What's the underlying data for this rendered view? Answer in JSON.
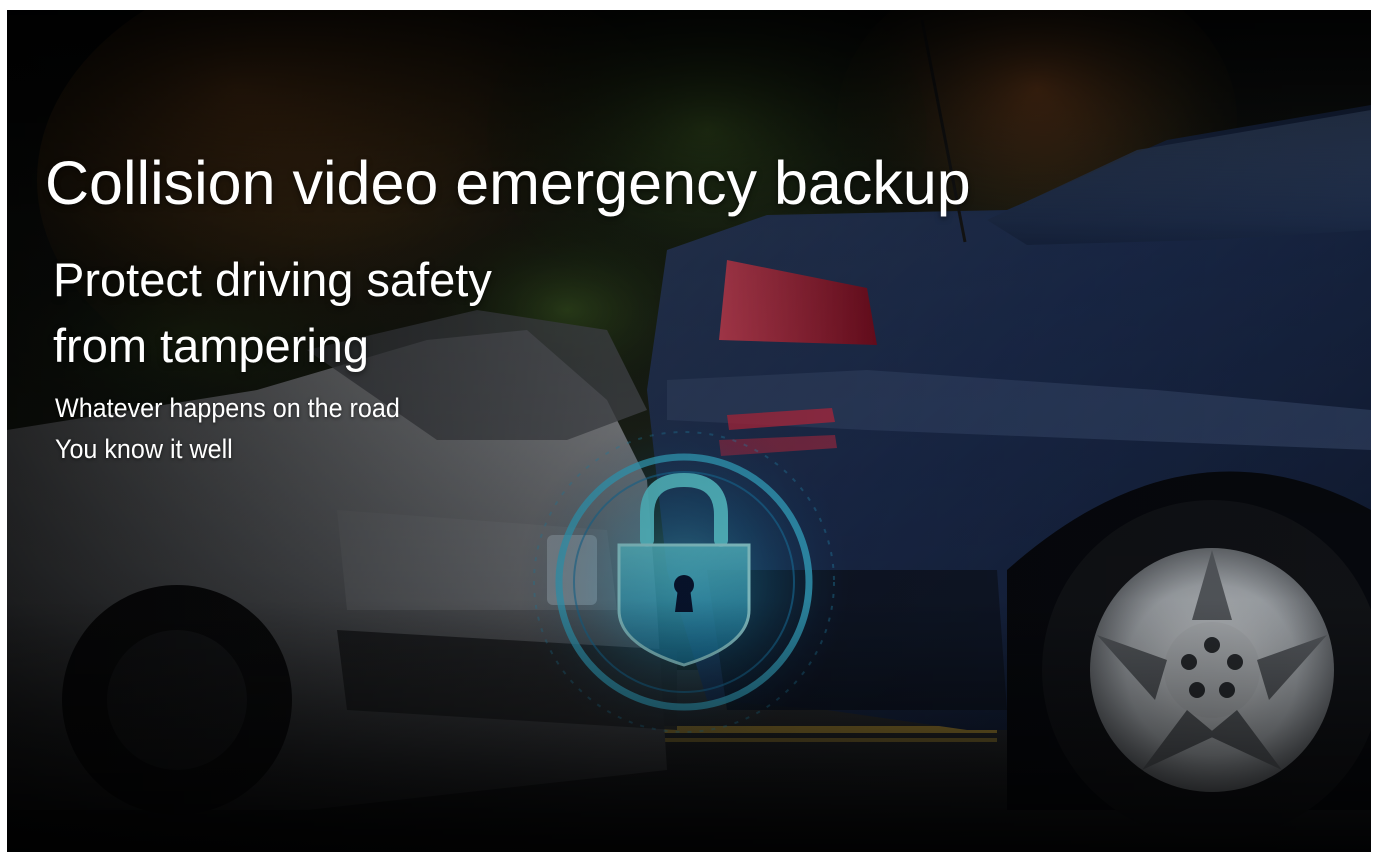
{
  "banner": {
    "headline": "Collision video emergency backup",
    "subheadline_lines": [
      "Protect driving safety",
      "from tampering"
    ],
    "tagline_lines": [
      "Whatever happens on the road",
      "You know it well"
    ]
  },
  "image": {
    "description_icon": "padlock-shield-icon",
    "accent_color": "#3fd4ff",
    "blue_car_color": "#1c2c4e",
    "silver_car_color": "#8c8f94"
  }
}
